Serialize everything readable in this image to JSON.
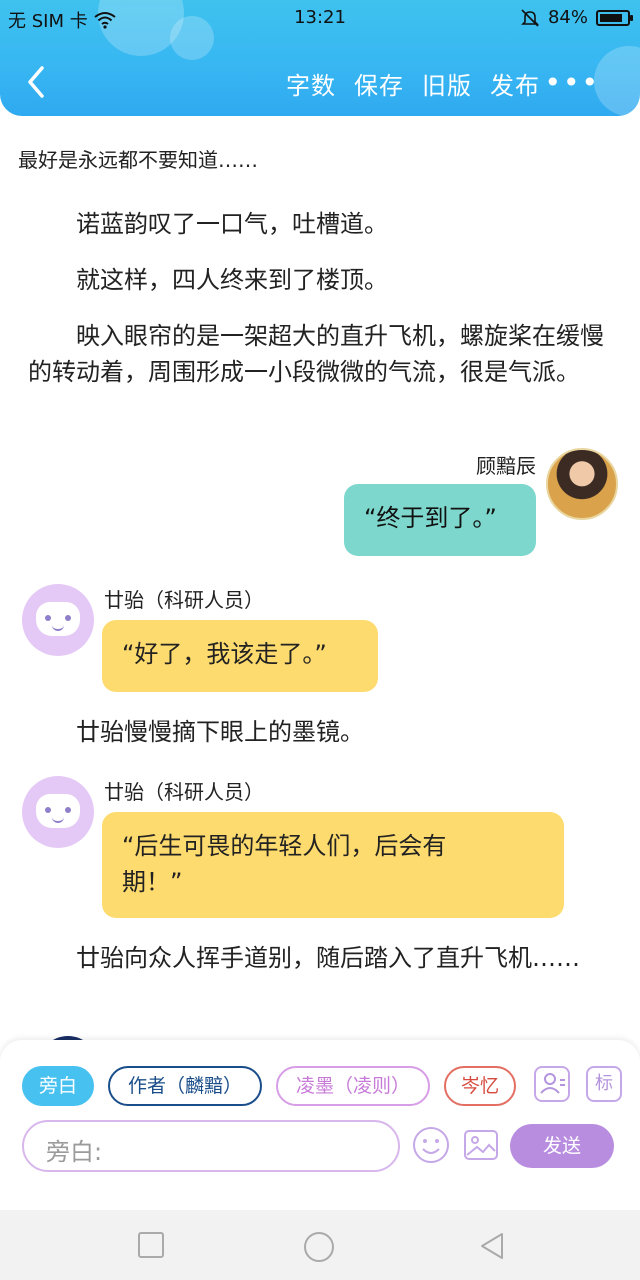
{
  "status_bar": {
    "carrier": "无 SIM 卡",
    "time": "13:21",
    "battery_percent": "84%",
    "battery_level": 0.84
  },
  "nav": {
    "actions": [
      "字数",
      "保存",
      "旧版",
      "发布"
    ],
    "more": "•••"
  },
  "content": {
    "top_line": "最好是永远都不要知道……",
    "paragraphs": {
      "p1": "诺蓝韵叹了一口气，吐槽道。",
      "p2": "就这样，四人终来到了楼顶。",
      "p3": "映入眼帘的是一架超大的直升飞机，螺旋桨在缓慢的转动着，周围形成一小段微微的气流，很是气派。",
      "p4": "廿骀慢慢摘下眼上的墨镜。",
      "p5": "廿骀向众人挥手道别，随后踏入了直升飞机……"
    },
    "messages": [
      {
        "speaker": "顾黯辰",
        "text": "“终于到了。”"
      },
      {
        "speaker": "廿骀（科研人员）",
        "text": "“好了，我该走了。”"
      },
      {
        "speaker": "廿骀（科研人员）",
        "text": "“后生可畏的年轻人们，后会有期！”"
      }
    ]
  },
  "composer": {
    "roles": [
      "旁白",
      "作者（麟黯）",
      "凌墨（凌则）",
      "岑忆"
    ],
    "tag_icon_label": "标",
    "input_placeholder": "旁白:",
    "send_label": "发送"
  },
  "colors": {
    "header": "#37b6f2",
    "teal_bubble": "#7dd7cd",
    "yellow_bubble": "#fedb6e",
    "send": "#b88de0"
  }
}
